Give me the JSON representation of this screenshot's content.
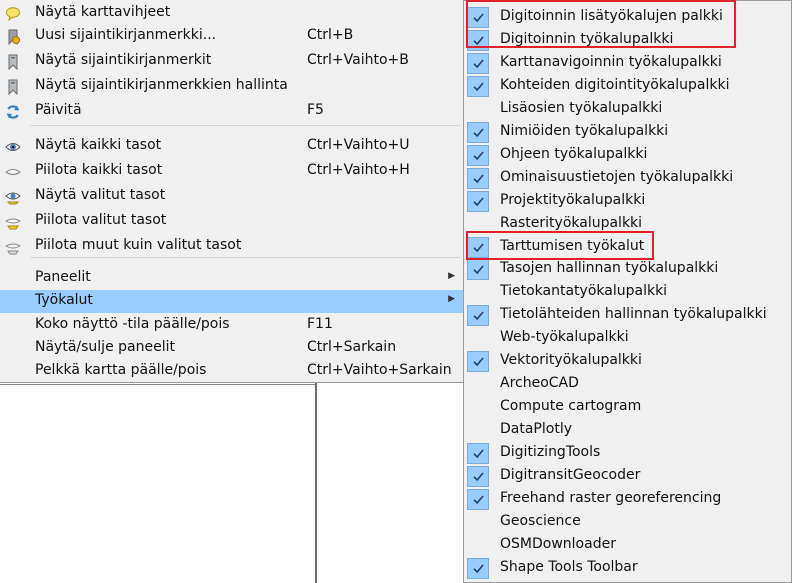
{
  "main_menu": {
    "items": [
      {
        "label": "Näytä karttavihjeet",
        "shortcut": "",
        "icon": "tooltip-bubble-icon"
      },
      {
        "label": "Uusi sijaintikirjanmerkki...",
        "shortcut": "Ctrl+B",
        "icon": "new-bookmark-icon"
      },
      {
        "label": "Näytä sijaintikirjanmerkit",
        "shortcut": "Ctrl+Vaihto+B",
        "icon": "bookmark-icon"
      },
      {
        "label": "Näytä sijaintikirjanmerkkien hallinta",
        "shortcut": "",
        "icon": "bookmark-manager-icon"
      },
      {
        "label": "Päivitä",
        "shortcut": "F5",
        "icon": "refresh-icon"
      },
      {
        "label": "Näytä kaikki tasot",
        "shortcut": "Ctrl+Vaihto+U",
        "icon": "eye-open-icon"
      },
      {
        "label": "Piilota kaikki tasot",
        "shortcut": "Ctrl+Vaihto+H",
        "icon": "eye-closed-icon"
      },
      {
        "label": "Näytä valitut tasot",
        "shortcut": "",
        "icon": "eye-selected-icon"
      },
      {
        "label": "Piilota valitut tasot",
        "shortcut": "",
        "icon": "hide-selected-icon"
      },
      {
        "label": "Piilota muut kuin valitut tasot",
        "shortcut": "",
        "icon": "hide-deselected-icon"
      },
      {
        "label": "Paneelit",
        "shortcut": "",
        "icon": ""
      },
      {
        "label": "Työkalut",
        "shortcut": "",
        "icon": ""
      },
      {
        "label": "Koko näyttö -tila päälle/pois",
        "shortcut": "F11",
        "icon": ""
      },
      {
        "label": "Näytä/sulje paneelit",
        "shortcut": "Ctrl+Sarkain",
        "icon": ""
      },
      {
        "label": "Pelkkä kartta päälle/pois",
        "shortcut": "Ctrl+Vaihto+Sarkain",
        "icon": ""
      }
    ],
    "highlighted": "Työkalut"
  },
  "toolbars_menu": {
    "items": [
      {
        "label": "Digitoinnin lisätyökalujen palkki",
        "checked": true
      },
      {
        "label": "Digitoinnin työkalupalkki",
        "checked": true
      },
      {
        "label": "Karttanavigoinnin työkalupalkki",
        "checked": true
      },
      {
        "label": "Kohteiden digitointityökalupalkki",
        "checked": true
      },
      {
        "label": "Lisäosien työkalupalkki",
        "checked": false
      },
      {
        "label": "Nimiöiden työkalupalkki",
        "checked": true
      },
      {
        "label": "Ohjeen työkalupalkki",
        "checked": true
      },
      {
        "label": "Ominaisuustietojen työkalupalkki",
        "checked": true
      },
      {
        "label": "Projektityökalupalkki",
        "checked": true
      },
      {
        "label": "Rasterityökalupalkki",
        "checked": false
      },
      {
        "label": "Tarttumisen työkalut",
        "checked": true
      },
      {
        "label": "Tasojen hallinnan työkalupalkki",
        "checked": true
      },
      {
        "label": "Tietokantatyökalupalkki",
        "checked": false
      },
      {
        "label": "Tietolähteiden hallinnan työkalupalkki",
        "checked": true
      },
      {
        "label": "Web-työkalupalkki",
        "checked": false
      },
      {
        "label": "Vektorityökalupalkki",
        "checked": true
      },
      {
        "label": "ArcheoCAD",
        "checked": false
      },
      {
        "label": "Compute cartogram",
        "checked": false
      },
      {
        "label": "DataPlotly",
        "checked": false
      },
      {
        "label": "DigitizingTools",
        "checked": true
      },
      {
        "label": "DigitransitGeocoder",
        "checked": true
      },
      {
        "label": "Freehand raster georeferencing",
        "checked": true
      },
      {
        "label": "Geoscience",
        "checked": false
      },
      {
        "label": "OSMDownloader",
        "checked": false
      },
      {
        "label": "Shape Tools Toolbar",
        "checked": true
      }
    ]
  },
  "colors": {
    "highlight": "#99ccff",
    "annotation_box": "#e0202a",
    "menu_bg": "#f0f0f0"
  }
}
